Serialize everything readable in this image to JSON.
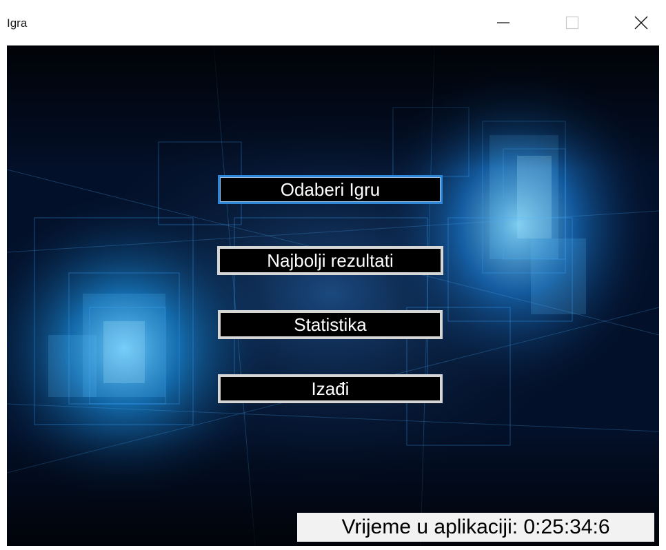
{
  "window": {
    "title": "Igra",
    "controls": {
      "minimize_icon": "minimize-icon",
      "maximize_icon": "maximize-icon",
      "close_icon": "close-icon"
    }
  },
  "menu": {
    "items": [
      {
        "label": "Odaberi Igru",
        "focused": true
      },
      {
        "label": "Najbolji rezultati",
        "focused": false
      },
      {
        "label": "Statistika",
        "focused": false
      },
      {
        "label": "Izađi",
        "focused": false
      }
    ]
  },
  "status": {
    "timer_text": "Vrijeme u aplikaciji: 0:25:34:6"
  },
  "colors": {
    "background_dark": "#020a1a",
    "glow_blue": "#1a8fe0",
    "button_bg": "#000000",
    "button_border": "#d6d6d6",
    "focus_border": "#2f86d6"
  }
}
